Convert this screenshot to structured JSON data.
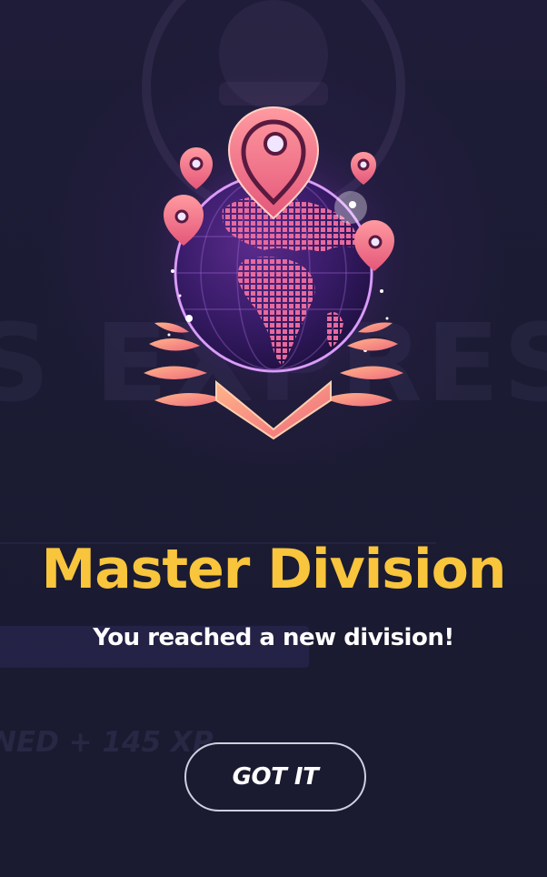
{
  "modal": {
    "title": "Master Division",
    "subtitle": "You reached a new division!",
    "button_label": "GOT IT"
  },
  "background": {
    "banner_text": "S EXPRESS",
    "xp_text": "NED + 145 XP"
  },
  "emblem": {
    "icon": "globe-with-location-pins-badge",
    "division": "Master"
  },
  "colors": {
    "background": "#1b1b33",
    "title": "#f8c53c",
    "subtitle": "#ffffff",
    "button_border": "#cfcfe0",
    "emblem_pink": "#f4788a",
    "emblem_purple": "#8a3dc4"
  }
}
